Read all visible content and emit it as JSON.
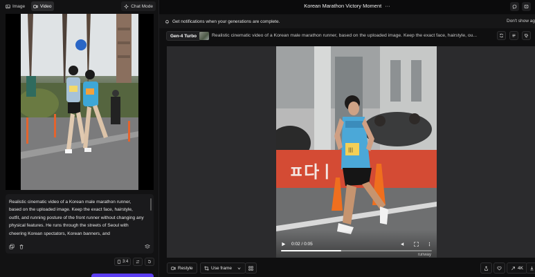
{
  "left_panel": {
    "modes": [
      {
        "label": "Image",
        "icon": "image-icon"
      },
      {
        "label": "Video",
        "icon": "video-icon",
        "active": true
      }
    ],
    "chat_mode_label": "Chat Mode",
    "prompt_text": "Realistic cinematic video of a Korean male marathon runner, based on the uploaded image. Keep the exact face, hairstyle, outfit, and running posture of the front runner without changing any physical features. He runs through the streets of Seoul with cheering Korean spectators, Korean banners, and",
    "aspect_ratio": "3:4"
  },
  "topbar": {
    "title": "Korean Marathon Victory Moment",
    "menu_glyph": "···"
  },
  "notification": {
    "text": "Get notifications when your generations are complete.",
    "dismiss_label": "Don't show ag"
  },
  "generation": {
    "model": "Gen-4 Turbo",
    "prompt": "Realistic cinematic video of a Korean male marathon runner, based on the uploaded image. Keep the exact face, hairstyle, ou..."
  },
  "video": {
    "current_time": "0:02",
    "duration": "0:05",
    "time_label": "0:02 / 0:05",
    "progress": 0.4,
    "watermark": "runway",
    "banner_text": "ㅍ다ㅣ"
  },
  "actions": {
    "restyle": "Restyle",
    "use_frame": "Use frame",
    "quality": "4K"
  },
  "colors": {
    "accent": "#5b3df0",
    "panel": "#121213",
    "video_bg": "#2b2b2d"
  }
}
